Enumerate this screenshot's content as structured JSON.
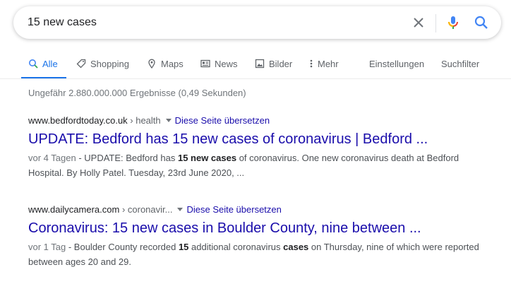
{
  "search": {
    "query": "15 new cases"
  },
  "tabs": [
    {
      "label": "Alle"
    },
    {
      "label": "Shopping"
    },
    {
      "label": "Maps"
    },
    {
      "label": "News"
    },
    {
      "label": "Bilder"
    },
    {
      "label": "Mehr"
    },
    {
      "label": "Einstellungen"
    },
    {
      "label": "Suchfilter"
    }
  ],
  "colors": {
    "accent": "#1a73e8",
    "link": "#1a0dab"
  },
  "stats": "Ungefähr 2.880.000.000 Ergebnisse (0,49 Sekunden)",
  "results": [
    {
      "domain": "www.bedfordtoday.co.uk",
      "path": " › health",
      "translate": "Diese Seite übersetzen",
      "title": "UPDATE: Bedford has 15 new cases of coronavirus | Bedford ...",
      "date": "vor 4 Tagen",
      "snippet_1": " - UPDATE: Bedford has ",
      "bold_1": "15 new cases",
      "snippet_2": " of coronavirus. One new coronavirus death at Bedford Hospital. By Holly Patel. Tuesday, 23rd June 2020, ...",
      "bold_2": "",
      "snippet_3": ""
    },
    {
      "domain": "www.dailycamera.com",
      "path": " › coronavir...",
      "translate": "Diese Seite übersetzen",
      "title": "Coronavirus: 15 new cases in Boulder County, nine between ...",
      "date": "vor 1 Tag",
      "snippet_1": " - Boulder County recorded ",
      "bold_1": "15",
      "snippet_2": " additional coronavirus ",
      "bold_2": "cases",
      "snippet_3": " on Thursday, nine of which were reported between ages 20 and 29."
    }
  ]
}
